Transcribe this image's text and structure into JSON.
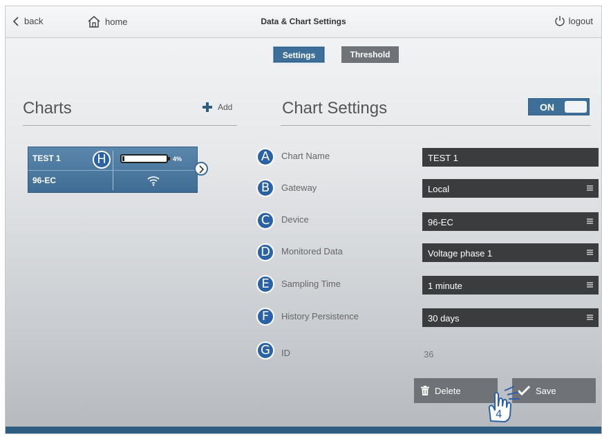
{
  "topbar": {
    "back_label": "back",
    "home_label": "home",
    "title": "Data & Chart Settings",
    "logout_label": "logout"
  },
  "tabs": [
    {
      "label": "Settings",
      "active": true
    },
    {
      "label": "Threshold",
      "active": false
    }
  ],
  "charts_panel": {
    "heading": "Charts",
    "add_label": "Add",
    "items": [
      {
        "name": "TEST 1",
        "device": "96-EC",
        "battery_percent": 4,
        "battery_text": "4%",
        "signal_icon": "wifi-icon"
      }
    ]
  },
  "chart_settings": {
    "heading": "Chart Settings",
    "toggle_label": "ON",
    "toggle_on": true,
    "fields": {
      "chart_name": {
        "label": "Chart Name",
        "value": "TEST 1"
      },
      "gateway": {
        "label": "Gateway",
        "value": "Local"
      },
      "device": {
        "label": "Device",
        "value": "96-EC"
      },
      "monitored_data": {
        "label": "Monitored Data",
        "value": "Voltage phase 1"
      },
      "sampling_time": {
        "label": "Sampling Time",
        "value": "1 minute"
      },
      "history_persistence": {
        "label": "History Persistence",
        "value": "30 days"
      },
      "id": {
        "label": "ID",
        "value": "36"
      }
    },
    "delete_label": "Delete",
    "save_label": "Save"
  },
  "annotations": {
    "chart_name": "A",
    "gateway": "B",
    "device": "C",
    "monitored_data": "D",
    "sampling_time": "E",
    "history_persistence": "F",
    "id": "G",
    "chart_card": "H",
    "step": "4"
  },
  "colors": {
    "accent": "#3d6f98",
    "dark_field": "#3a3c3e",
    "button_gray": "#6f7377",
    "badge_blue": "#2b62a6"
  }
}
